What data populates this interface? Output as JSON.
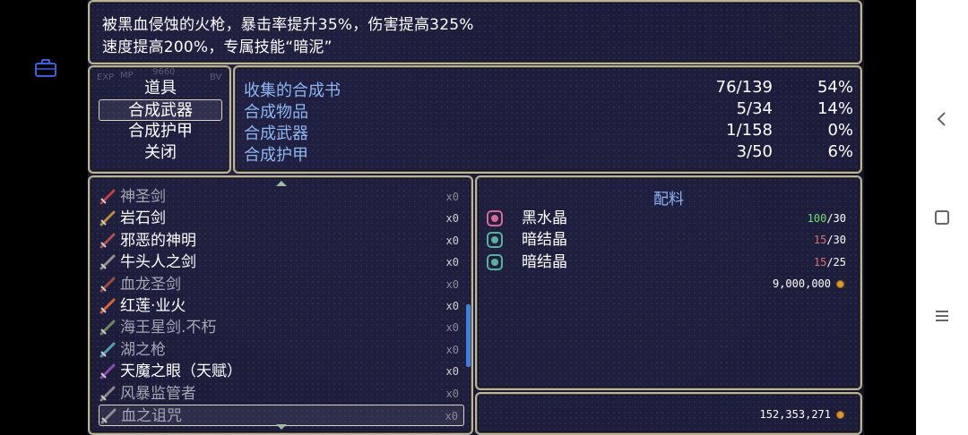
{
  "help": {
    "line1": "被黑血侵蚀的火枪，暴击率提升35%，伤害提高325%",
    "line2": "速度提高200%，专属技能“暗泥”"
  },
  "commands": [
    {
      "label": "道具"
    },
    {
      "label": "合成武器",
      "selected": true
    },
    {
      "label": "合成护甲"
    },
    {
      "label": "关闭"
    }
  ],
  "ghost": {
    "exp": "EXP",
    "mp": "MP",
    "val": "9660",
    "bv": "BV"
  },
  "stats": [
    {
      "name": "收集的合成书",
      "count": "76/139",
      "pct": "54%"
    },
    {
      "name": "合成物品",
      "count": "5/34",
      "pct": "14%"
    },
    {
      "name": "合成武器",
      "count": "1/158",
      "pct": "0%"
    },
    {
      "name": "合成护甲",
      "count": "3/50",
      "pct": "6%"
    }
  ],
  "items": [
    {
      "name": "神圣剑",
      "qty": "x0",
      "dim": true,
      "icon": "holy-sword-icon",
      "color": "#c04040"
    },
    {
      "name": "岩石剑",
      "qty": "x0",
      "dim": false,
      "icon": "rock-sword-icon",
      "color": "#c08a3a"
    },
    {
      "name": "邪恶的神明",
      "qty": "x0",
      "dim": false,
      "icon": "evil-god-sword-icon",
      "color": "#b05050"
    },
    {
      "name": "牛头人之剑",
      "qty": "x0",
      "dim": false,
      "icon": "minotaur-sword-icon",
      "color": "#909090"
    },
    {
      "name": "血龙圣剑",
      "qty": "x0",
      "dim": true,
      "icon": "blood-dragon-sword-icon",
      "color": "#a04a3a"
    },
    {
      "name": "红莲·业火",
      "qty": "x0",
      "dim": false,
      "icon": "red-lotus-icon",
      "color": "#e06030"
    },
    {
      "name": "海王星剑.不朽",
      "qty": "x0",
      "dim": true,
      "icon": "neptune-sword-icon",
      "color": "#6a8a5a"
    },
    {
      "name": "湖之枪",
      "qty": "x0",
      "dim": true,
      "icon": "lake-spear-icon",
      "color": "#50a0b0"
    },
    {
      "name": "天魔之眼（天赋）",
      "qty": "x0",
      "dim": false,
      "icon": "demon-eye-icon",
      "color": "#8a4ab0"
    },
    {
      "name": "风暴监管者",
      "qty": "x0",
      "dim": true,
      "icon": "storm-warden-icon",
      "color": "#8a8a8a"
    },
    {
      "name": "血之诅咒",
      "qty": "x0",
      "dim": true,
      "selected": true,
      "icon": "blood-curse-icon",
      "color": "#909090"
    }
  ],
  "materials": {
    "title": "配料",
    "rows": [
      {
        "name": "黑水晶",
        "have": "100",
        "need": "/30",
        "ok": true,
        "icon": "black-crystal-icon",
        "color": "#d86a9a"
      },
      {
        "name": "暗结晶",
        "have": "15",
        "need": "/30",
        "ok": false,
        "icon": "dark-crystal-icon",
        "color": "#5ab0a0"
      },
      {
        "name": "暗结晶",
        "have": "15",
        "need": "/25",
        "ok": false,
        "icon": "dark-crystal-icon",
        "color": "#5ab0a0"
      }
    ],
    "cost": "9,000,000"
  },
  "gold": "152,353,271",
  "colors": {
    "accent_blue": "#8eb6f2",
    "ok_green": "#6fe06f",
    "bad_red": "#e07070",
    "frame": "#b9b39a"
  }
}
